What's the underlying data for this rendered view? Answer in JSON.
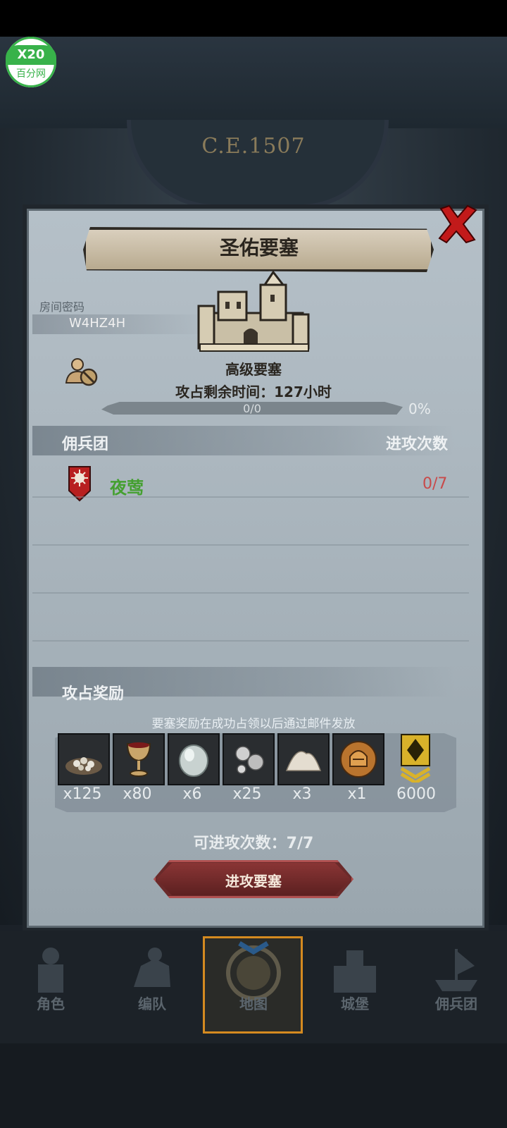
{
  "logo": {
    "top": "X20",
    "bottom": "百分网"
  },
  "era": "C.E.1507",
  "dialog": {
    "title": "圣佑要塞",
    "room_label": "房间密码",
    "room_code": "W4HZ4H",
    "fortress_level": "高级要塞",
    "time_label": "攻占剩余时间：",
    "time_value": "127",
    "time_unit": "小时",
    "progress_text": "0/0",
    "progress_pct": "0%",
    "progress_fraction": 0,
    "mercenary_header": "佣兵团",
    "attacks_header": "进攻次数",
    "mercenaries": [
      {
        "name": "夜莺",
        "attempts": "0/7"
      }
    ],
    "reward_header": "攻占奖励",
    "reward_note": "要塞奖励在成功占领以后通过邮件发放",
    "rewards": [
      {
        "icon": "ore-pile-icon",
        "qty": "x125"
      },
      {
        "icon": "goblet-icon",
        "qty": "x80"
      },
      {
        "icon": "gem-icon",
        "qty": "x6"
      },
      {
        "icon": "silver-ore-icon",
        "qty": "x25"
      },
      {
        "icon": "salt-pile-icon",
        "qty": "x3"
      },
      {
        "icon": "helmet-medal-icon",
        "qty": "x1"
      },
      {
        "icon": "rank-badge-icon",
        "qty": "6000"
      }
    ],
    "remaining_label": "可进攻次数：7/7",
    "attack_button": "进攻要塞"
  },
  "nav": [
    {
      "label": "角色",
      "active": false
    },
    {
      "label": "编队",
      "active": false
    },
    {
      "label": "地图",
      "active": true
    },
    {
      "label": "城堡",
      "active": false
    },
    {
      "label": "佣兵团",
      "active": false
    }
  ],
  "colors": {
    "accent_green": "#44a030",
    "attempts_red": "#c84a4a",
    "button_red": "#6a2a2a",
    "nav_active": "#d48a20"
  }
}
